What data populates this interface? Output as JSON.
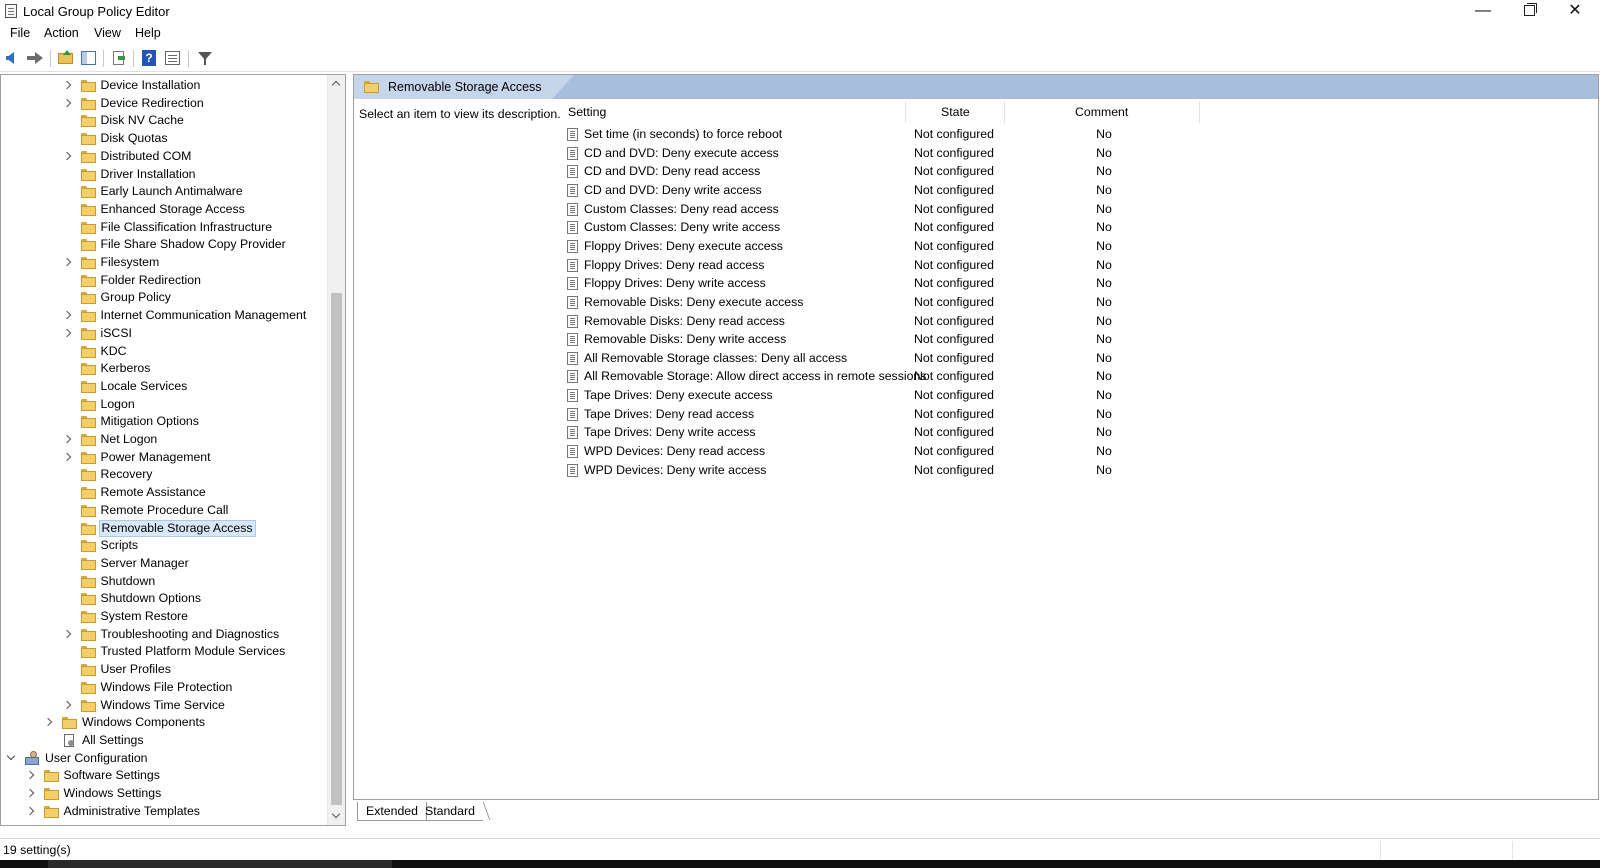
{
  "window": {
    "title": "Local Group Policy Editor"
  },
  "menu": [
    "File",
    "Action",
    "View",
    "Help"
  ],
  "tree": [
    {
      "label": "Device Installation",
      "expandable": true,
      "depth": 2,
      "icon": "folder-icon"
    },
    {
      "label": "Device Redirection",
      "expandable": true,
      "depth": 2,
      "icon": "folder-icon"
    },
    {
      "label": "Disk NV Cache",
      "expandable": false,
      "depth": 2,
      "icon": "folder-icon"
    },
    {
      "label": "Disk Quotas",
      "expandable": false,
      "depth": 2,
      "icon": "folder-icon"
    },
    {
      "label": "Distributed COM",
      "expandable": true,
      "depth": 2,
      "icon": "folder-icon"
    },
    {
      "label": "Driver Installation",
      "expandable": false,
      "depth": 2,
      "icon": "folder-icon"
    },
    {
      "label": "Early Launch Antimalware",
      "expandable": false,
      "depth": 2,
      "icon": "folder-icon"
    },
    {
      "label": "Enhanced Storage Access",
      "expandable": false,
      "depth": 2,
      "icon": "folder-icon"
    },
    {
      "label": "File Classification Infrastructure",
      "expandable": false,
      "depth": 2,
      "icon": "folder-icon"
    },
    {
      "label": "File Share Shadow Copy Provider",
      "expandable": false,
      "depth": 2,
      "icon": "folder-icon"
    },
    {
      "label": "Filesystem",
      "expandable": true,
      "depth": 2,
      "icon": "folder-icon"
    },
    {
      "label": "Folder Redirection",
      "expandable": false,
      "depth": 2,
      "icon": "folder-icon"
    },
    {
      "label": "Group Policy",
      "expandable": false,
      "depth": 2,
      "icon": "folder-icon"
    },
    {
      "label": "Internet Communication Management",
      "expandable": true,
      "depth": 2,
      "icon": "folder-icon"
    },
    {
      "label": "iSCSI",
      "expandable": true,
      "depth": 2,
      "icon": "folder-icon"
    },
    {
      "label": "KDC",
      "expandable": false,
      "depth": 2,
      "icon": "folder-icon"
    },
    {
      "label": "Kerberos",
      "expandable": false,
      "depth": 2,
      "icon": "folder-icon"
    },
    {
      "label": "Locale Services",
      "expandable": false,
      "depth": 2,
      "icon": "folder-icon"
    },
    {
      "label": "Logon",
      "expandable": false,
      "depth": 2,
      "icon": "folder-icon"
    },
    {
      "label": "Mitigation Options",
      "expandable": false,
      "depth": 2,
      "icon": "folder-icon"
    },
    {
      "label": "Net Logon",
      "expandable": true,
      "depth": 2,
      "icon": "folder-icon"
    },
    {
      "label": "Power Management",
      "expandable": true,
      "depth": 2,
      "icon": "folder-icon"
    },
    {
      "label": "Recovery",
      "expandable": false,
      "depth": 2,
      "icon": "folder-icon"
    },
    {
      "label": "Remote Assistance",
      "expandable": false,
      "depth": 2,
      "icon": "folder-icon"
    },
    {
      "label": "Remote Procedure Call",
      "expandable": false,
      "depth": 2,
      "icon": "folder-icon"
    },
    {
      "label": "Removable Storage Access",
      "expandable": false,
      "depth": 2,
      "icon": "folder-icon",
      "selected": true
    },
    {
      "label": "Scripts",
      "expandable": false,
      "depth": 2,
      "icon": "folder-icon"
    },
    {
      "label": "Server Manager",
      "expandable": false,
      "depth": 2,
      "icon": "folder-icon"
    },
    {
      "label": "Shutdown",
      "expandable": false,
      "depth": 2,
      "icon": "folder-icon"
    },
    {
      "label": "Shutdown Options",
      "expandable": false,
      "depth": 2,
      "icon": "folder-icon"
    },
    {
      "label": "System Restore",
      "expandable": false,
      "depth": 2,
      "icon": "folder-icon"
    },
    {
      "label": "Troubleshooting and Diagnostics",
      "expandable": true,
      "depth": 2,
      "icon": "folder-icon"
    },
    {
      "label": "Trusted Platform Module Services",
      "expandable": false,
      "depth": 2,
      "icon": "folder-icon"
    },
    {
      "label": "User Profiles",
      "expandable": false,
      "depth": 2,
      "icon": "folder-icon"
    },
    {
      "label": "Windows File Protection",
      "expandable": false,
      "depth": 2,
      "icon": "folder-icon"
    },
    {
      "label": "Windows Time Service",
      "expandable": true,
      "depth": 2,
      "icon": "folder-icon"
    },
    {
      "label": "Windows Components",
      "expandable": true,
      "depth": 1,
      "icon": "folder-icon"
    },
    {
      "label": "All Settings",
      "expandable": false,
      "depth": 1,
      "icon": "settings-doc-icon"
    },
    {
      "label": "User Configuration",
      "expandable": true,
      "expanded": true,
      "depth": -1,
      "icon": "user-config-icon"
    },
    {
      "label": "Software Settings",
      "expandable": true,
      "depth": 0,
      "icon": "folder-icon"
    },
    {
      "label": "Windows Settings",
      "expandable": true,
      "depth": 0,
      "icon": "folder-icon"
    },
    {
      "label": "Administrative Templates",
      "expandable": true,
      "depth": 0,
      "icon": "folder-icon"
    }
  ],
  "details": {
    "header_title": "Removable Storage Access",
    "description": "Select an item to view its description.",
    "columns": {
      "setting": "Setting",
      "state": "State",
      "comment": "Comment"
    },
    "rows": [
      {
        "setting": "Set time (in seconds) to force reboot",
        "state": "Not configured",
        "comment": "No"
      },
      {
        "setting": "CD and DVD: Deny execute access",
        "state": "Not configured",
        "comment": "No"
      },
      {
        "setting": "CD and DVD: Deny read access",
        "state": "Not configured",
        "comment": "No"
      },
      {
        "setting": "CD and DVD: Deny write access",
        "state": "Not configured",
        "comment": "No"
      },
      {
        "setting": "Custom Classes: Deny read access",
        "state": "Not configured",
        "comment": "No"
      },
      {
        "setting": "Custom Classes: Deny write access",
        "state": "Not configured",
        "comment": "No"
      },
      {
        "setting": "Floppy Drives: Deny execute access",
        "state": "Not configured",
        "comment": "No"
      },
      {
        "setting": "Floppy Drives: Deny read access",
        "state": "Not configured",
        "comment": "No"
      },
      {
        "setting": "Floppy Drives: Deny write access",
        "state": "Not configured",
        "comment": "No"
      },
      {
        "setting": "Removable Disks: Deny execute access",
        "state": "Not configured",
        "comment": "No"
      },
      {
        "setting": "Removable Disks: Deny read access",
        "state": "Not configured",
        "comment": "No"
      },
      {
        "setting": "Removable Disks: Deny write access",
        "state": "Not configured",
        "comment": "No"
      },
      {
        "setting": "All Removable Storage classes: Deny all access",
        "state": "Not configured",
        "comment": "No"
      },
      {
        "setting": "All Removable Storage: Allow direct access in remote sessions",
        "state": "Not configured",
        "comment": "No"
      },
      {
        "setting": "Tape Drives: Deny execute access",
        "state": "Not configured",
        "comment": "No"
      },
      {
        "setting": "Tape Drives: Deny read access",
        "state": "Not configured",
        "comment": "No"
      },
      {
        "setting": "Tape Drives: Deny write access",
        "state": "Not configured",
        "comment": "No"
      },
      {
        "setting": "WPD Devices: Deny read access",
        "state": "Not configured",
        "comment": "No"
      },
      {
        "setting": "WPD Devices: Deny write access",
        "state": "Not configured",
        "comment": "No"
      }
    ]
  },
  "bottom_tabs": {
    "extended": "Extended",
    "standard": "Standard"
  },
  "status": {
    "text": "19 setting(s)"
  },
  "colors": {
    "header_bar": "#a7bfdc",
    "selection": "#d9e8f7",
    "folder": "#f3cf6b"
  }
}
